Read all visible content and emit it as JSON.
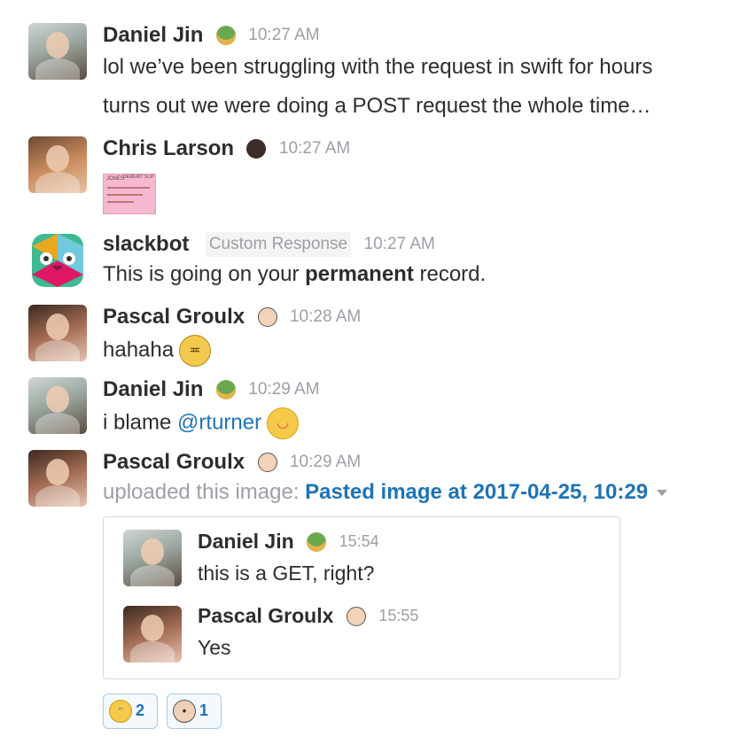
{
  "messages": [
    {
      "author": "Daniel Jin",
      "time": "10:27 AM",
      "lines": [
        "lol we’ve been struggling with the request in swift for hours",
        "turns out we were doing a POST request the whole time…"
      ],
      "status_icon": "salad-icon"
    },
    {
      "author": "Chris Larson",
      "time": "10:27 AM",
      "status_icon": "dark-face-icon",
      "attachment_thumb": {
        "text_lines": [
          "JONES",
          "DEMERIT SLIP"
        ]
      }
    },
    {
      "author": "slackbot",
      "tag": "Custom Response",
      "time": "10:27 AM",
      "text_before": "This is going on your ",
      "text_bold": "permanent",
      "text_after": " record."
    },
    {
      "author": "Pascal Groulx",
      "time": "10:28 AM",
      "status_icon": "bearded-face-icon",
      "text": "hahaha",
      "emoji": "smirk-emoji-icon"
    },
    {
      "author": "Daniel Jin",
      "time": "10:29 AM",
      "status_icon": "salad-icon",
      "text": "i blame ",
      "mention": "@rturner",
      "emoji": "tongue-out-emoji-icon"
    },
    {
      "author": "Pascal Groulx",
      "time": "10:29 AM",
      "status_icon": "bearded-face-icon",
      "uploaded_label": "uploaded this image: ",
      "uploaded_link": "Pasted image at 2017-04-25, 10:29"
    }
  ],
  "shared_card": {
    "items": [
      {
        "author": "Daniel Jin",
        "time": "15:54",
        "text": "this is a GET, right?"
      },
      {
        "author": "Pascal Groulx",
        "time": "15:55",
        "text": "Yes"
      }
    ]
  },
  "reactions": [
    {
      "icon": "joy-emoji-icon",
      "count": "2"
    },
    {
      "icon": "person-emoji-icon",
      "count": "1"
    }
  ],
  "colors": {
    "link": "#1d74b8",
    "muted": "#9e9ea6",
    "text": "#2c2d30"
  }
}
